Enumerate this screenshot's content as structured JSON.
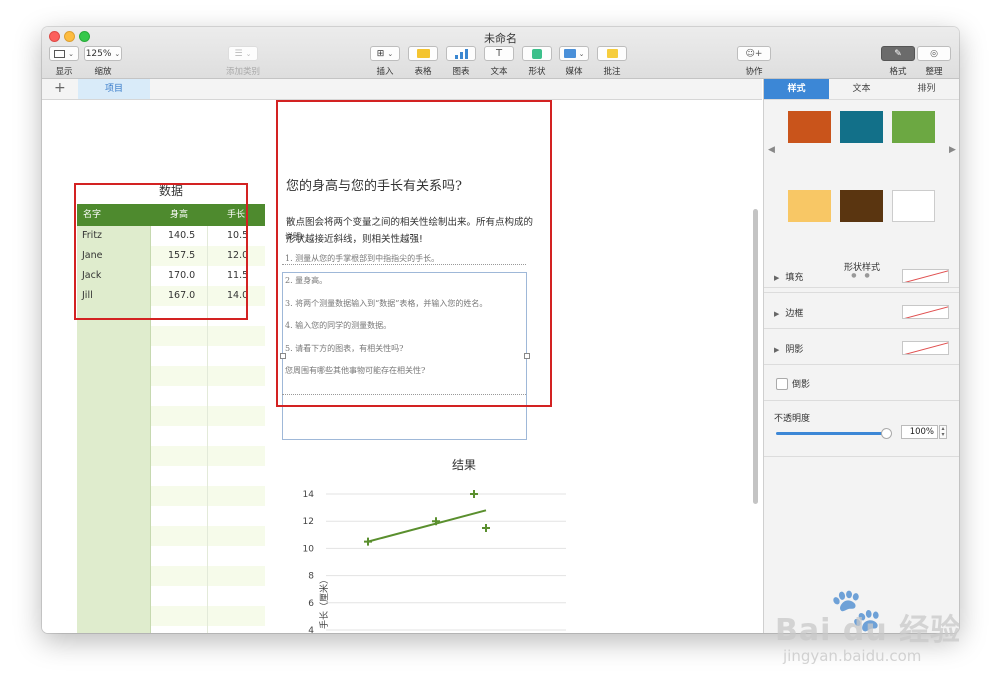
{
  "window": {
    "title": "未命名"
  },
  "toolbar": {
    "view": {
      "label": "显示"
    },
    "zoom": {
      "value": "125%",
      "label": "缩放"
    },
    "add_category": {
      "label": "添加类别"
    },
    "insert": {
      "label": "插入"
    },
    "table": {
      "label": "表格"
    },
    "chart": {
      "label": "图表"
    },
    "text": {
      "label": "文本"
    },
    "shape": {
      "label": "形状"
    },
    "media": {
      "label": "媒体"
    },
    "comment": {
      "label": "批注"
    },
    "collaborate": {
      "label": "协作"
    },
    "format": {
      "label": "格式"
    },
    "organize": {
      "label": "整理"
    }
  },
  "sheets": {
    "active": "项目"
  },
  "table": {
    "title": "数据",
    "headers": [
      "名字",
      "身高",
      "手长"
    ],
    "rows": [
      [
        "Fritz",
        "140.5",
        "10.5"
      ],
      [
        "Jane",
        "157.5",
        "12.0"
      ],
      [
        "Jack",
        "170.0",
        "11.5"
      ],
      [
        "Jill",
        "167.0",
        "14.0"
      ]
    ]
  },
  "textbox": {
    "heading": "您的身高与您的手长有关系吗?",
    "paragraph": "散点图会将两个变量之间的相关性绘制出来。所有点构成的形状越接近斜线，则相关性越强!",
    "notes": [
      "说明:",
      "1.  测量从您的手掌根部到中指指尖的手长。",
      "2.  量身高。",
      "3.  将两个测量数据输入到“数据”表格，并输入您的姓名。",
      "4.  输入您的同学的测量数据。",
      "5.  请看下方的图表，有相关性吗?",
      "您周围有哪些其他事物可能存在相关性?"
    ]
  },
  "chart_data": {
    "type": "scatter",
    "title": "结果",
    "ylabel": "手长（厘米）",
    "xlabel": "",
    "y_ticks": [
      14,
      12,
      10,
      8,
      6,
      4
    ],
    "ylim": [
      4,
      14
    ],
    "xlim": [
      130,
      190
    ],
    "points": [
      {
        "x": 140.5,
        "y": 10.5
      },
      {
        "x": 157.5,
        "y": 12.0
      },
      {
        "x": 170.0,
        "y": 11.5
      },
      {
        "x": 167.0,
        "y": 14.0
      }
    ],
    "trendline": {
      "x": [
        140.5,
        170.0
      ],
      "y": [
        10.5,
        12.8
      ]
    },
    "color": "#5a8f2e"
  },
  "sidebar": {
    "tabs": [
      "样式",
      "文本",
      "排列"
    ],
    "active_tab": "样式",
    "swatches": [
      "#c9541b",
      "#127089",
      "#6ca842",
      "#f8c765",
      "#5a3510",
      "#ffffff"
    ],
    "shape_style_label": "形状样式",
    "fill_label": "填充",
    "border_label": "边框",
    "shadow_label": "阴影",
    "reflection_label": "倒影",
    "opacity_label": "不透明度",
    "opacity_value": "100%",
    "opacity": 1.0
  },
  "watermark": {
    "brand": "Bai du 经验",
    "url": "jingyan.baidu.com"
  }
}
